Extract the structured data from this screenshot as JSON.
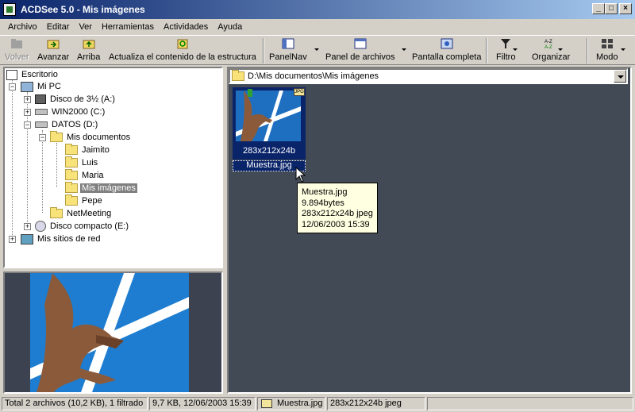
{
  "window": {
    "title": "ACDSee 5.0 - Mis imágenes",
    "btn_min": "_",
    "btn_max": "□",
    "btn_close": "×"
  },
  "menu": [
    "Archivo",
    "Editar",
    "Ver",
    "Herramientas",
    "Actividades",
    "Ayuda"
  ],
  "toolbar": {
    "volver": "Volver",
    "avanzar": "Avanzar",
    "arriba": "Arriba",
    "actualiza": "Actualiza el contenido de la estructura",
    "panelnav": "PanelNav",
    "panel_archivos": "Panel de archivos",
    "pantalla_completa": "Pantalla completa",
    "filtro": "Filtro",
    "organizar": "Organizar",
    "modo": "Modo"
  },
  "tree": {
    "escritorio": "Escritorio",
    "mi_pc": "Mi PC",
    "disco_a": "Disco de 3½ (A:)",
    "win2000": "WIN2000 (C:)",
    "datos": "DATOS (D:)",
    "mis_documentos": "Mis documentos",
    "jaimito": "Jaimito",
    "luis": "Luis",
    "maria": "Maria",
    "mis_imagenes": "Mis imágenes",
    "pepe": "Pepe",
    "netmeeting": "NetMeeting",
    "disco_compacto": "Disco compacto (E:)",
    "mis_sitios": "Mis sitios de red"
  },
  "address": {
    "path": "D:\\Mis documentos\\Mis imágenes"
  },
  "thumbnail": {
    "badge": "JPG",
    "caption": "283x212x24b",
    "filename": "Muestra.jpg"
  },
  "tooltip": {
    "line1": "Muestra.jpg",
    "line2": "9.894bytes",
    "line3": "283x212x24b jpeg",
    "line4": "12/06/2003 15:39"
  },
  "status": {
    "total": "Total 2 archivos (10,2 KB), 1 filtrado",
    "size_date": "9,7 KB, 12/06/2003 15:39",
    "file": "Muestra.jpg",
    "info": "283x212x24b jpeg"
  }
}
